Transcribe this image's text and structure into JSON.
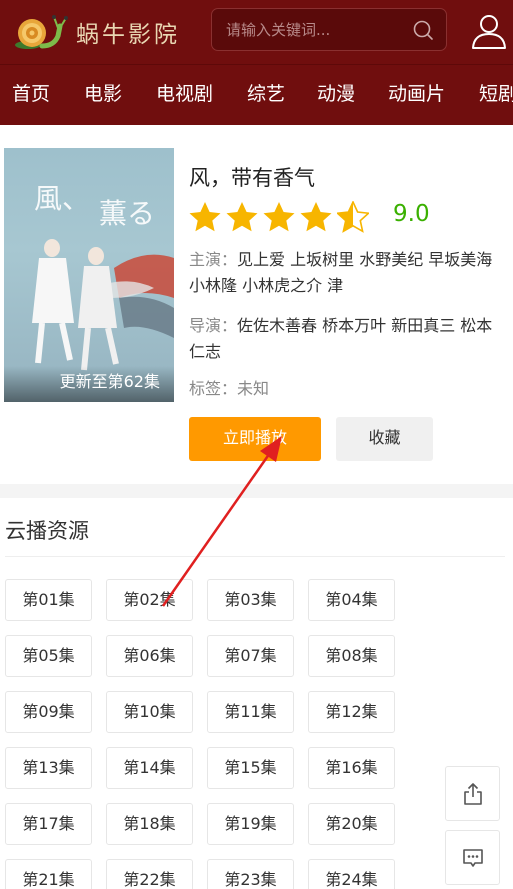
{
  "header": {
    "logo_text": "蜗牛影院",
    "search_placeholder": "请输入关键词...",
    "icons": [
      "snail-logo",
      "search-icon",
      "user-icon"
    ]
  },
  "nav": {
    "items": [
      "首页",
      "电影",
      "电视剧",
      "综艺",
      "动漫",
      "动画片",
      "短剧"
    ]
  },
  "detail": {
    "title": "风，带有香气",
    "rating": "9.0",
    "stars_filled": 4.5,
    "stars_total": 5,
    "poster_badge": "更新至第62集",
    "cast_label": "主演：",
    "cast": "见上爱 上坂树里 水野美纪 早坂美海 小林隆 小林虎之介 津",
    "director_label": "导演：",
    "director": "佐佐木善春 桥本万叶 新田真三 松本仁志",
    "tags_label": "标签：",
    "tags": "未知",
    "play_button": "立即播放",
    "favorite_button": "收藏"
  },
  "sources": {
    "title": "云播资源",
    "episodes": [
      "第01集",
      "第02集",
      "第03集",
      "第04集",
      "第05集",
      "第06集",
      "第07集",
      "第08集",
      "第09集",
      "第10集",
      "第11集",
      "第12集",
      "第13集",
      "第14集",
      "第15集",
      "第16集",
      "第17集",
      "第18集",
      "第19集",
      "第20集",
      "第21集",
      "第22集",
      "第23集",
      "第24集"
    ]
  },
  "float": {
    "icons": [
      "share-icon",
      "comment-icon"
    ]
  },
  "colors": {
    "header_bg": "#700e0e",
    "play_button": "#ff9900",
    "star": "#f7b500",
    "score": "#3ab000",
    "annotation_arrow": "#e02020"
  }
}
